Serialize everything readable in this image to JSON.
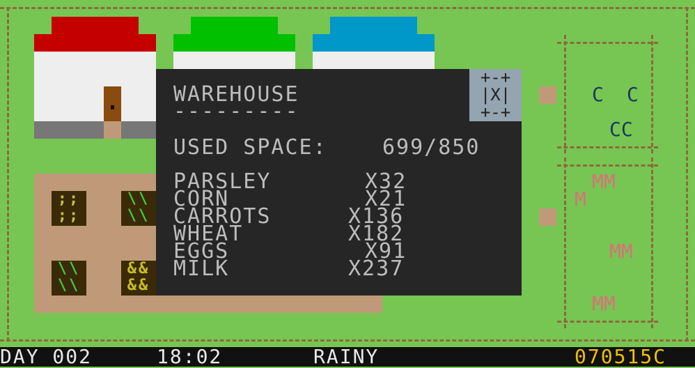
{
  "colors": {
    "grass": "#77c653",
    "house_red": "#c40000",
    "house_green": "#00c000",
    "house_blue": "#0098c8",
    "modal_bg": "#262626",
    "modal_text": "#bdbdbd",
    "money": "#f3c000"
  },
  "farm": {
    "crops": [
      {
        "glyphs": ";;\n;;",
        "color": "#c8c040"
      },
      {
        "glyphs": "\\\\\n\\\\",
        "color": "#40d040"
      },
      {
        "glyphs": "\\\\\n\\\\",
        "color": "#40d040"
      },
      {
        "glyphs": "&&\n&&",
        "color": "#c8c020"
      }
    ]
  },
  "pens": {
    "chicken_pen": {
      "animals": [
        "C",
        "C",
        "CC"
      ]
    },
    "cow_pen": {
      "animals": [
        "MM",
        "M",
        "MM",
        "MM"
      ]
    }
  },
  "warehouse": {
    "title": "WAREHOUSE",
    "underline": "---------",
    "used_space_label": "USED SPACE:",
    "used_space_value": "699/850",
    "close_label": "X",
    "close_frame": "+-+\n|X|\n+-+",
    "items": [
      {
        "name": "PARSLEY",
        "qty": "X32"
      },
      {
        "name": "CORN",
        "qty": "X21"
      },
      {
        "name": "CARROTS",
        "qty": "X136"
      },
      {
        "name": "WHEAT",
        "qty": "X182"
      },
      {
        "name": "EGGS",
        "qty": "X91"
      },
      {
        "name": "MILK",
        "qty": "X237"
      }
    ]
  },
  "hud": {
    "day": "DAY 002",
    "time": "18:02",
    "weather": "RAINY",
    "money": "070515C"
  }
}
